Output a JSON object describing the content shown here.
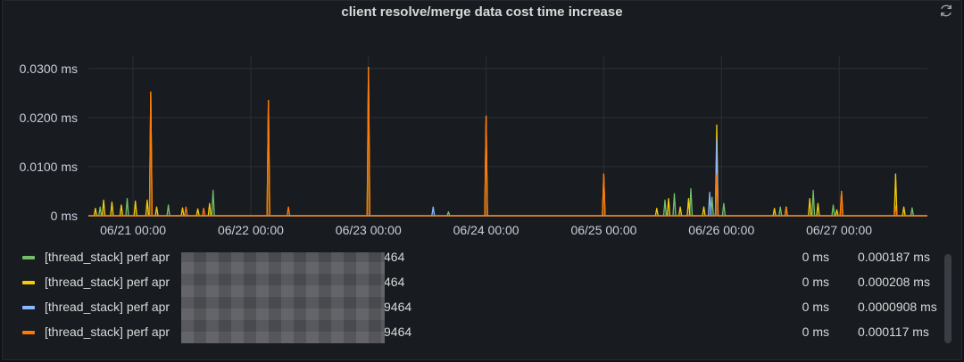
{
  "panel": {
    "title": "client resolve/merge data cost time increase",
    "refresh_icon": "refresh-icon"
  },
  "colors": {
    "green": "#73bf69",
    "yellow": "#f2cc0c",
    "blue": "#8ab8ff",
    "orange": "#ff780a",
    "grid": "#2c2f34",
    "axis_text": "#ccccdc"
  },
  "chart_data": {
    "type": "line",
    "y_ticks": [
      {
        "value": 0,
        "label": "0 ms"
      },
      {
        "value": 0.01,
        "label": "0.0100 ms"
      },
      {
        "value": 0.02,
        "label": "0.0200 ms"
      },
      {
        "value": 0.03,
        "label": "0.0300 ms"
      }
    ],
    "ylim": [
      0,
      0.0325
    ],
    "x_ticks": [
      {
        "value": 21,
        "label": "06/21 00:00"
      },
      {
        "value": 22,
        "label": "06/22 00:00"
      },
      {
        "value": 23,
        "label": "06/23 00:00"
      },
      {
        "value": 24,
        "label": "06/24 00:00"
      },
      {
        "value": 25,
        "label": "06/25 00:00"
      },
      {
        "value": 26,
        "label": "06/26 00:00"
      },
      {
        "value": 27,
        "label": "06/27 00:00"
      }
    ],
    "xlim": [
      20.62,
      27.75
    ],
    "grid": true,
    "legend_position": "bottom",
    "series": [
      {
        "color": "#73bf69",
        "spikes": [
          [
            20.72,
            0.0018
          ],
          [
            20.95,
            0.0035
          ],
          [
            21.3,
            0.0022
          ],
          [
            21.68,
            0.0052
          ],
          [
            23.68,
            0.0008
          ],
          [
            25.52,
            0.0032
          ],
          [
            25.6,
            0.0045
          ],
          [
            25.74,
            0.0055
          ],
          [
            25.92,
            0.0038
          ],
          [
            26.02,
            0.0025
          ],
          [
            26.5,
            0.0018
          ],
          [
            26.78,
            0.0052
          ],
          [
            26.95,
            0.0022
          ],
          [
            27.62,
            0.0016
          ]
        ]
      },
      {
        "color": "#f2cc0c",
        "spikes": [
          [
            20.68,
            0.0015
          ],
          [
            20.75,
            0.0032
          ],
          [
            20.82,
            0.0028
          ],
          [
            20.9,
            0.0022
          ],
          [
            21.02,
            0.003
          ],
          [
            21.12,
            0.0032
          ],
          [
            21.15,
            0.0252
          ],
          [
            21.2,
            0.0018
          ],
          [
            21.42,
            0.0016
          ],
          [
            21.55,
            0.0014
          ],
          [
            21.65,
            0.0025
          ],
          [
            22.15,
            0.0235
          ],
          [
            23.0,
            0.0302
          ],
          [
            24.0,
            0.0203
          ],
          [
            25.0,
            0.0085
          ],
          [
            25.45,
            0.0015
          ],
          [
            25.55,
            0.0035
          ],
          [
            25.65,
            0.0018
          ],
          [
            25.72,
            0.0035
          ],
          [
            25.85,
            0.0018
          ],
          [
            25.96,
            0.0185
          ],
          [
            26.45,
            0.0015
          ],
          [
            26.55,
            0.0018
          ],
          [
            26.75,
            0.0035
          ],
          [
            26.82,
            0.0025
          ],
          [
            26.98,
            0.0012
          ],
          [
            27.02,
            0.005
          ],
          [
            27.48,
            0.0085
          ],
          [
            27.55,
            0.0018
          ]
        ]
      },
      {
        "color": "#8ab8ff",
        "spikes": [
          [
            23.55,
            0.0018
          ],
          [
            25.9,
            0.0048
          ],
          [
            25.96,
            0.0155
          ]
        ]
      },
      {
        "color": "#ff780a",
        "spikes": [
          [
            21.15,
            0.0252
          ],
          [
            21.45,
            0.0018
          ],
          [
            21.6,
            0.0015
          ],
          [
            22.15,
            0.0235
          ],
          [
            22.32,
            0.0018
          ],
          [
            23.0,
            0.03
          ],
          [
            24.0,
            0.0203
          ],
          [
            25.0,
            0.0085
          ],
          [
            25.96,
            0.0085
          ],
          [
            26.55,
            0.0015
          ],
          [
            27.02,
            0.005
          ],
          [
            27.48,
            0.002
          ]
        ]
      }
    ]
  },
  "legend": {
    "rows": [
      {
        "name_prefix": "[thread_stack] perf apr",
        "name_suffix": "464",
        "color": "#73bf69",
        "min": "0 ms",
        "max": "0.000187 ms"
      },
      {
        "name_prefix": "[thread_stack] perf apr",
        "name_suffix": "464",
        "color": "#f2cc0c",
        "min": "0 ms",
        "max": "0.000208 ms"
      },
      {
        "name_prefix": "[thread_stack] perf apr",
        "name_suffix": "9464",
        "color": "#8ab8ff",
        "min": "0 ms",
        "max": "0.0000908 ms"
      },
      {
        "name_prefix": "[thread_stack] perf apr",
        "name_suffix": "9464",
        "color": "#ff780a",
        "min": "0 ms",
        "max": "0.000117 ms"
      }
    ]
  }
}
